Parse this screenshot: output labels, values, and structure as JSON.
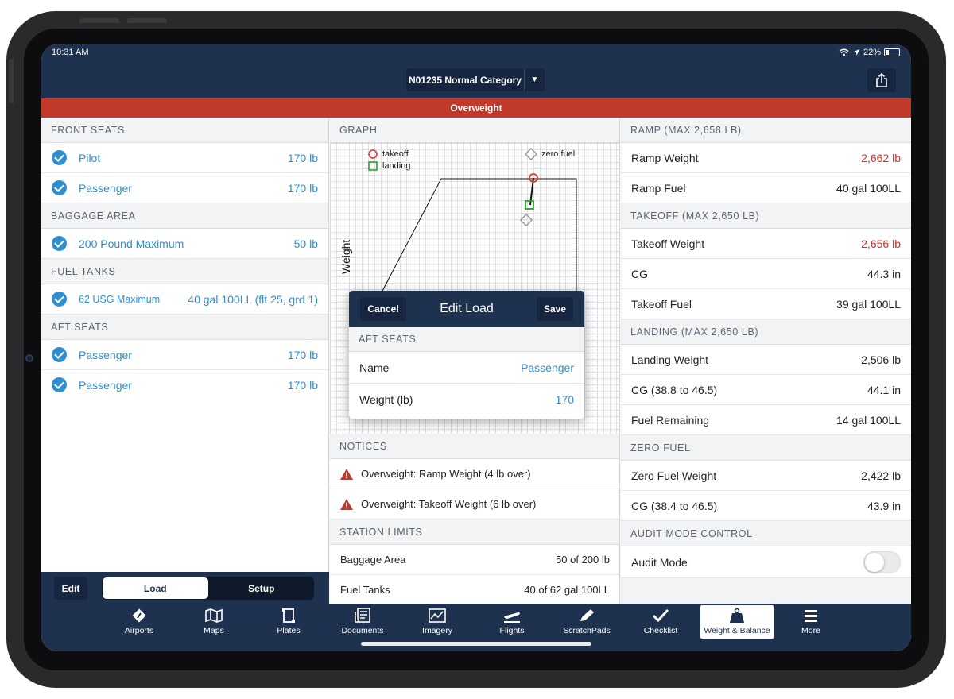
{
  "status": {
    "time": "10:31 AM",
    "battery": "22%"
  },
  "header": {
    "title": "N01235 Normal Category"
  },
  "alert": {
    "text": "Overweight"
  },
  "left": {
    "sections": [
      {
        "title": "FRONT SEATS",
        "rows": [
          {
            "label": "Pilot",
            "value": "170 lb"
          },
          {
            "label": "Passenger",
            "value": "170 lb"
          }
        ]
      },
      {
        "title": "BAGGAGE AREA",
        "rows": [
          {
            "label": "200 Pound Maximum",
            "value": "50 lb"
          }
        ]
      },
      {
        "title": "FUEL TANKS",
        "rows": [
          {
            "label": "62 USG Maximum",
            "value": "40 gal 100LL (flt 25, grd 1)"
          }
        ]
      },
      {
        "title": "AFT SEATS",
        "rows": [
          {
            "label": "Passenger",
            "value": "170 lb"
          },
          {
            "label": "Passenger",
            "value": "170 lb"
          }
        ]
      }
    ],
    "edit_label": "Edit",
    "segments": {
      "load": "Load",
      "setup": "Setup"
    }
  },
  "graph": {
    "title": "GRAPH",
    "ylabel": "Weight",
    "legend": {
      "takeoff": "takeoff",
      "landing": "landing",
      "zero_fuel": "zero fuel"
    }
  },
  "popover": {
    "cancel": "Cancel",
    "title": "Edit Load",
    "save": "Save",
    "section": "AFT SEATS",
    "name_label": "Name",
    "name_value": "Passenger",
    "weight_label": "Weight (lb)",
    "weight_value": "170"
  },
  "notices": {
    "title": "NOTICES",
    "items": [
      "Overweight: Ramp Weight (4 lb over)",
      "Overweight: Takeoff Weight (6 lb over)"
    ]
  },
  "station_limits": {
    "title": "STATION LIMITS",
    "rows": [
      {
        "label": "Baggage Area",
        "value": "50 of 200 lb"
      },
      {
        "label": "Fuel Tanks",
        "value": "40 of 62 gal 100LL"
      }
    ]
  },
  "right": {
    "ramp": {
      "title": "RAMP (MAX 2,658 LB)",
      "rows": [
        {
          "label": "Ramp Weight",
          "value": "2,662 lb"
        },
        {
          "label": "Ramp Fuel",
          "value": "40 gal 100LL"
        }
      ]
    },
    "takeoff": {
      "title": "TAKEOFF (MAX 2,650 LB)",
      "rows": [
        {
          "label": "Takeoff Weight",
          "value": "2,656 lb"
        },
        {
          "label": "CG",
          "value": "44.3 in"
        },
        {
          "label": "Takeoff Fuel",
          "value": "39 gal 100LL"
        }
      ]
    },
    "landing": {
      "title": "LANDING (MAX 2,650 LB)",
      "rows": [
        {
          "label": "Landing Weight",
          "value": "2,506 lb"
        },
        {
          "label": "CG (38.8 to 46.5)",
          "value": "44.1 in"
        },
        {
          "label": "Fuel Remaining",
          "value": "14 gal 100LL"
        }
      ]
    },
    "zero_fuel": {
      "title": "ZERO FUEL",
      "rows": [
        {
          "label": "Zero Fuel Weight",
          "value": "2,422 lb"
        },
        {
          "label": "CG (38.4 to 46.5)",
          "value": "43.9 in"
        }
      ]
    },
    "audit": {
      "title": "AUDIT MODE CONTROL",
      "label": "Audit Mode"
    }
  },
  "tabs": [
    {
      "label": "Airports",
      "icon": "airports-icon"
    },
    {
      "label": "Maps",
      "icon": "maps-icon"
    },
    {
      "label": "Plates",
      "icon": "plates-icon"
    },
    {
      "label": "Documents",
      "icon": "documents-icon"
    },
    {
      "label": "Imagery",
      "icon": "imagery-icon"
    },
    {
      "label": "Flights",
      "icon": "flights-icon"
    },
    {
      "label": "ScratchPads",
      "icon": "scratchpads-icon"
    },
    {
      "label": "Checklist",
      "icon": "checklist-icon"
    },
    {
      "label": "Weight & Balance",
      "icon": "weight-balance-icon",
      "active": true
    },
    {
      "label": "More",
      "icon": "more-icon"
    }
  ],
  "colors": {
    "navy": "#1e3250",
    "alert_red": "#c0392b",
    "link_blue": "#2e8fd0"
  }
}
